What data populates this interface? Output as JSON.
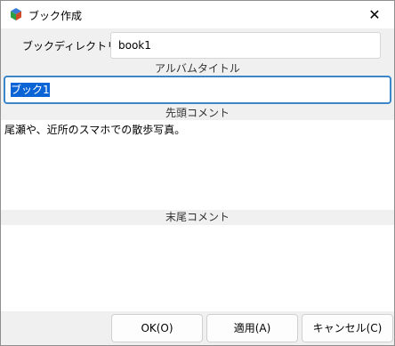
{
  "window": {
    "title": "ブック作成",
    "icon": "book-cube-icon",
    "close_glyph": "✕"
  },
  "directory": {
    "label": "ブックディレクトリ",
    "value": "book1"
  },
  "album_title": {
    "label": "アルバムタイトル",
    "value": "ブック1"
  },
  "head_comment": {
    "label": "先頭コメント",
    "value": "尾瀬や、近所のスマホでの散歩写真。"
  },
  "tail_comment": {
    "label": "末尾コメント",
    "value": ""
  },
  "buttons": {
    "ok": "OK(O)",
    "apply": "適用(A)",
    "cancel": "キャンセル(C)"
  },
  "colors": {
    "focus_border": "#3a86c8",
    "selection": "#0a64d6"
  }
}
